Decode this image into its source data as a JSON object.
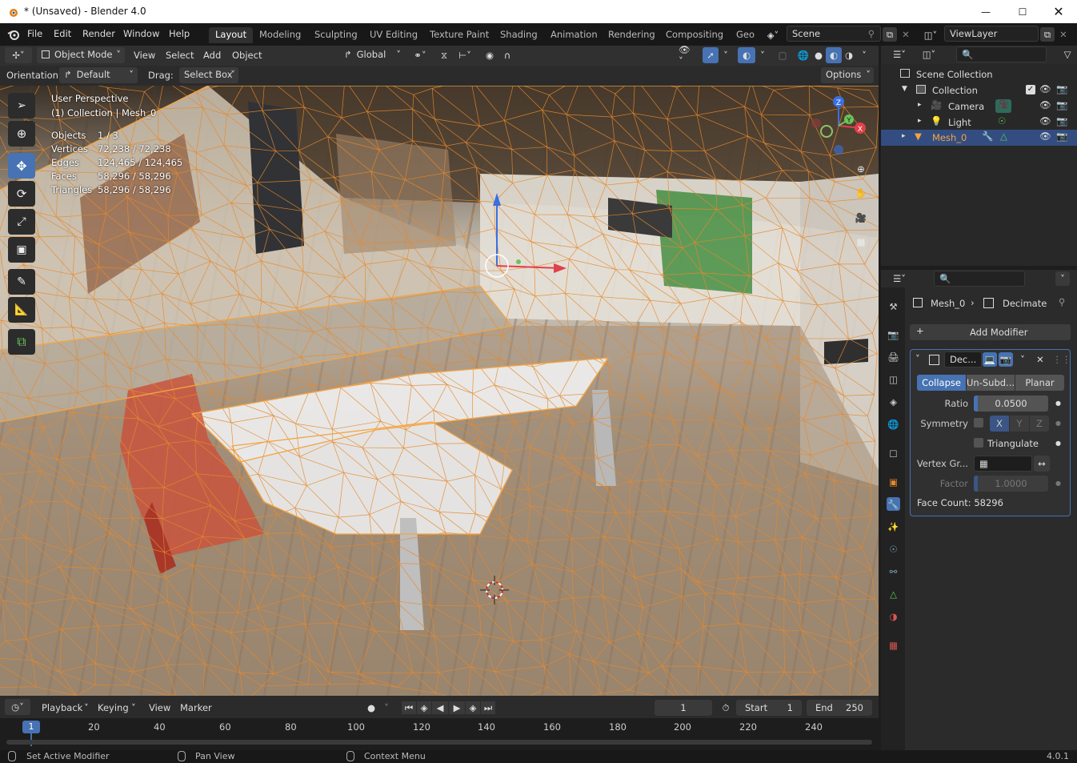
{
  "window": {
    "title": "* (Unsaved) - Blender 4.0"
  },
  "menu": [
    "File",
    "Edit",
    "Render",
    "Window",
    "Help"
  ],
  "workspaces": [
    "Layout",
    "Modeling",
    "Sculpting",
    "UV Editing",
    "Texture Paint",
    "Shading",
    "Animation",
    "Rendering",
    "Compositing",
    "Geo"
  ],
  "scene": {
    "name": "Scene",
    "view_layer": "ViewLayer"
  },
  "viewport_header": {
    "mode": "Object Mode",
    "menus": [
      "View",
      "Select",
      "Add",
      "Object"
    ],
    "transform": "Global"
  },
  "tool_settings": {
    "orientation_label": "Orientation:",
    "orientation": "Default",
    "drag_label": "Drag:",
    "drag": "Select Box",
    "options": "Options"
  },
  "overlay": {
    "perspective": "User Perspective",
    "collection": "(1) Collection | Mesh_0",
    "stats": [
      {
        "label": "Objects",
        "value": "1 / 3"
      },
      {
        "label": "Vertices",
        "value": "72,238 / 72,238"
      },
      {
        "label": "Edges",
        "value": "124,465 / 124,465"
      },
      {
        "label": "Faces",
        "value": "58,296 / 58,296"
      },
      {
        "label": "Triangles",
        "value": "58,296 / 58,296"
      }
    ]
  },
  "gizmo": {
    "x": "X",
    "y": "Y",
    "z": "Z"
  },
  "timeline": {
    "menus": [
      "Playback",
      "Keying",
      "View",
      "Marker"
    ],
    "current_frame": "1",
    "start_label": "Start",
    "start": "1",
    "end_label": "End",
    "end": "250",
    "ticks": [
      "20",
      "40",
      "60",
      "80",
      "100",
      "120",
      "140",
      "160",
      "180",
      "200",
      "220",
      "240"
    ],
    "playhead": "1"
  },
  "status": {
    "items": [
      "Set Active Modifier",
      "Pan View",
      "Context Menu"
    ],
    "version": "4.0.1"
  },
  "outliner": {
    "root": "Scene Collection",
    "items": [
      {
        "label": "Collection"
      },
      {
        "label": "Camera"
      },
      {
        "label": "Light"
      },
      {
        "label": "Mesh_0"
      }
    ]
  },
  "properties": {
    "breadcrumb_object": "Mesh_0",
    "breadcrumb_modifier": "Decimate",
    "add_modifier": "Add Modifier",
    "modifier_name": "Dec...",
    "modes": [
      "Collapse",
      "Un-Subd...",
      "Planar"
    ],
    "ratio_label": "Ratio",
    "ratio": "0.0500",
    "symmetry_label": "Symmetry",
    "axes": [
      "X",
      "Y",
      "Z"
    ],
    "triangulate": "Triangulate",
    "vertex_group_label": "Vertex Gr...",
    "factor_label": "Factor",
    "factor": "1.0000",
    "face_count": "Face Count: 58296"
  },
  "colors": {
    "accent": "#4772b3",
    "wire": "#e8882a",
    "active_object": "#f5a442"
  }
}
